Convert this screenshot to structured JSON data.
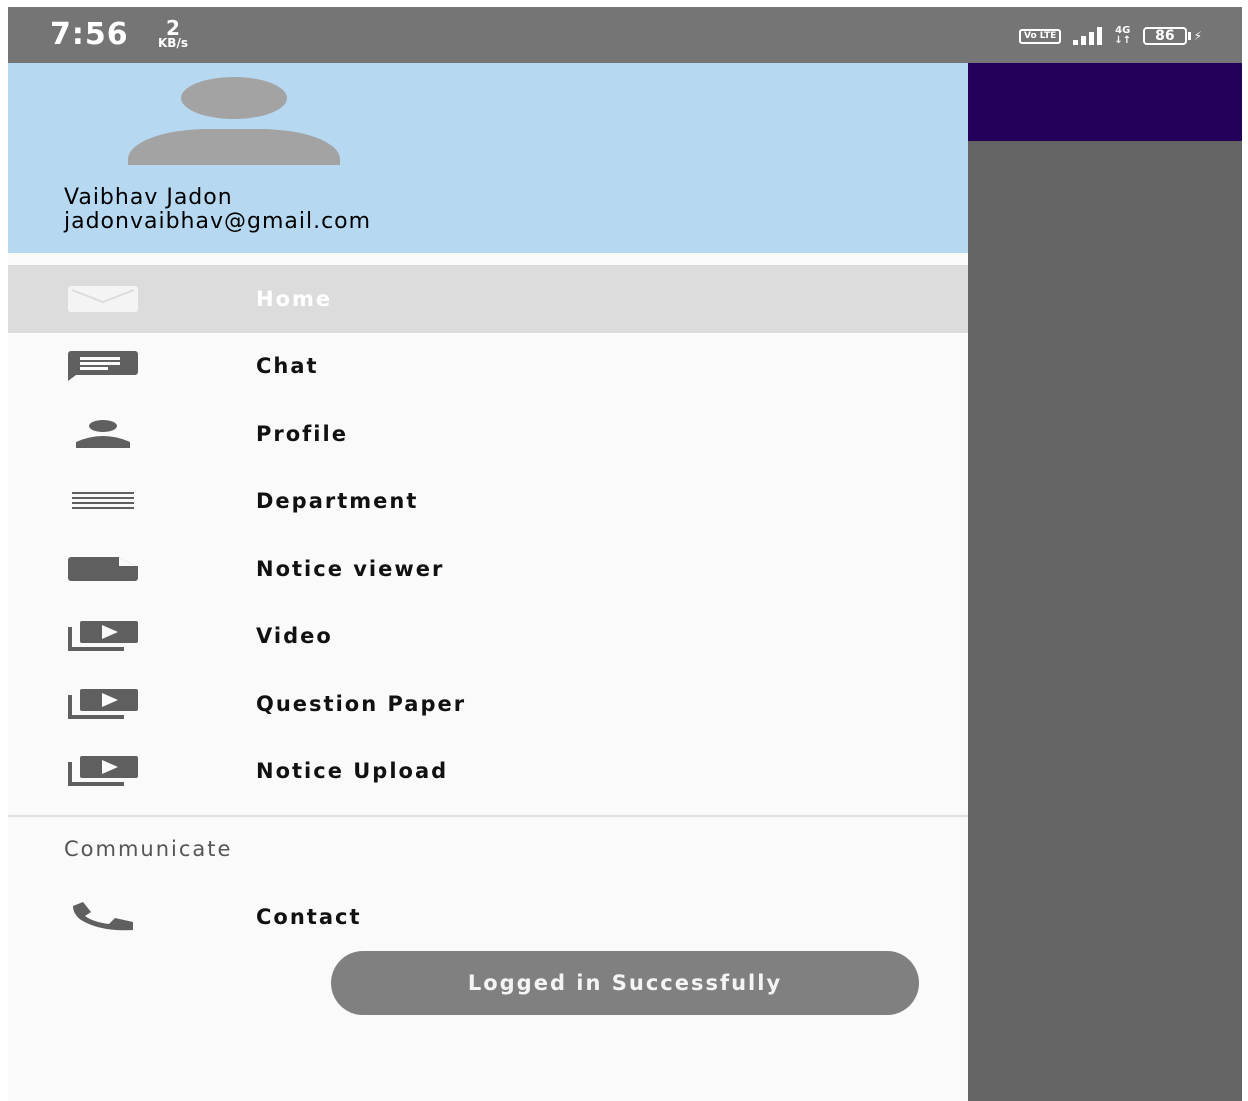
{
  "status_bar": {
    "time": "7:56",
    "net_speed_value": "2",
    "net_speed_unit": "KB/s",
    "volte": "Vo LTE",
    "network": "4G",
    "battery": "86"
  },
  "drawer": {
    "header": {
      "name": "Vaibhav Jadon",
      "email": "jadonvaibhav@gmail.com"
    },
    "items": [
      {
        "label": "Home",
        "icon": "mail-icon",
        "active": true
      },
      {
        "label": "Chat",
        "icon": "chat-icon"
      },
      {
        "label": "Profile",
        "icon": "person-icon"
      },
      {
        "label": "Department",
        "icon": "list-lines-icon"
      },
      {
        "label": "Notice viewer",
        "icon": "document-icon"
      },
      {
        "label": "Video",
        "icon": "video-library-icon"
      },
      {
        "label": "Question Paper",
        "icon": "video-library-icon"
      },
      {
        "label": "Notice Upload",
        "icon": "video-library-icon"
      }
    ],
    "section_title": "Communicate",
    "contact": {
      "label": "Contact",
      "icon": "phone-icon"
    }
  },
  "toast": {
    "message": "Logged in Successfully"
  },
  "colors": {
    "header_bg": "#b7d8f1",
    "app_bar": "#24005a",
    "scrim": "#646464",
    "active_item_bg": "#dcdcdc"
  }
}
